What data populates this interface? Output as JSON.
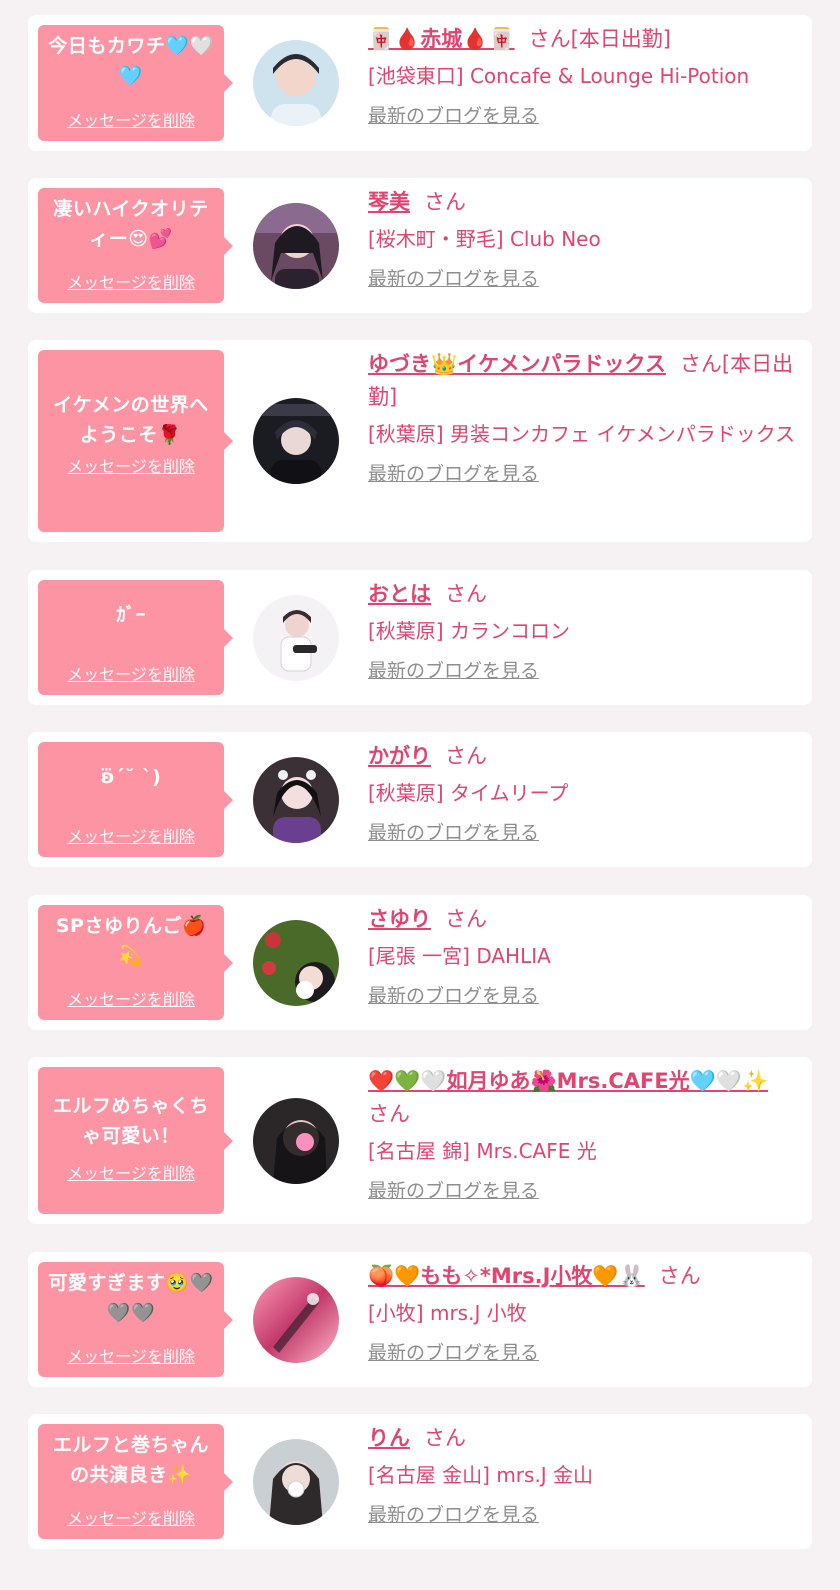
{
  "common": {
    "delete_label": "メッセージを削除",
    "san": "さん",
    "blog_label": "最新のブログを見る"
  },
  "colors": {
    "bubble": "#fd94a4",
    "accent": "#e0446f",
    "muted": "#8e8e8e",
    "card": "#ffffff",
    "background": "#f6f1f3"
  },
  "items": [
    {
      "message": "今日もカワチ🩵🤍🩵",
      "name": "🀄🩸赤城🩸🀄",
      "suffix": "[本日出勤]",
      "shop": "[池袋東口] Concafe & Lounge Hi-Potion"
    },
    {
      "message": "凄いハイクオリティー😍💕",
      "name": "琴美",
      "suffix": "",
      "shop": "[桜木町・野毛] Club Neo"
    },
    {
      "message": "イケメンの世界へようこそ🌹",
      "name": "ゆづき👑イケメンパラドックス",
      "suffix": "[本日出勤]",
      "shop": "[秋葉原] 男装コンカフェ イケメンパラドックス"
    },
    {
      "message": "ｶﾞｰ",
      "name": "おとは",
      "suffix": "",
      "shop": "[秋葉原] カランコロン"
    },
    {
      "message": "ʚ⃛ˊ˘ ˋ)",
      "name": "かがり",
      "suffix": "",
      "shop": "[秋葉原] タイムリープ"
    },
    {
      "message": "SPさゆりんご🍎💫",
      "name": "さゆり",
      "suffix": "",
      "shop": "[尾張 一宮] DAHLIA"
    },
    {
      "message": "エルフめちゃくちゃ可愛い！",
      "name": "❤️💚🤍如月ゆあ🌺Mrs.CAFE光🩵🤍✨",
      "suffix": "",
      "shop": "[名古屋 錦] Mrs.CAFE 光"
    },
    {
      "message": "可愛すぎます🥹🩶🩶🩶",
      "name": "🍑🧡もも✧*Mrs.J小牧🧡🐰",
      "suffix": "",
      "shop": "[小牧] mrs.J 小牧"
    },
    {
      "message": "エルフと巻ちゃんの共演良き✨",
      "name": "りん",
      "suffix": "",
      "shop": "[名古屋 金山] mrs.J 金山"
    }
  ]
}
